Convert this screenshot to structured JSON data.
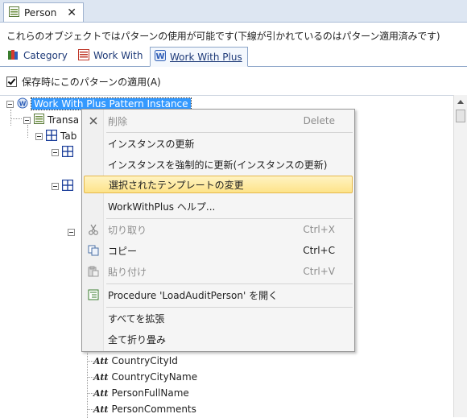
{
  "doc_tab": {
    "label": "Person",
    "close": "✕"
  },
  "description": "これらのオブジェクトではパターンの使用が可能です(下線が引かれているのはパターン適用済みです)",
  "pattern_tabs": [
    {
      "label": "Category",
      "icon": "category-icon"
    },
    {
      "label": "Work With",
      "icon": "work-with-icon"
    },
    {
      "label": "Work With Plus",
      "icon": "work-with-plus-icon",
      "active": true
    }
  ],
  "apply_on_save": {
    "label": "保存時にこのパターンの適用(A)",
    "checked": true
  },
  "tree": {
    "root": "Work With Plus Pattern Instance",
    "transaction": "Transa",
    "table": "Tab",
    "attributes": [
      "CountryCityId",
      "CountryCityName",
      "PersonFullName",
      "PersonComments"
    ]
  },
  "context_menu": {
    "items": [
      {
        "label": "削除",
        "shortcut": "Delete",
        "disabled": true,
        "icon": "delete-icon"
      },
      {
        "label": "インスタンスの更新"
      },
      {
        "label": "インスタンスを強制的に更新(インスタンスの更新)"
      },
      {
        "label": "選択されたテンプレートの変更",
        "highlighted": true
      },
      {
        "label": "WorkWithPlus ヘルプ..."
      },
      {
        "label": "切り取り",
        "shortcut": "Ctrl+X",
        "disabled": true,
        "icon": "cut-icon"
      },
      {
        "label": "コピー",
        "shortcut": "Ctrl+C",
        "icon": "copy-icon"
      },
      {
        "label": "貼り付け",
        "shortcut": "Ctrl+V",
        "disabled": true,
        "icon": "paste-icon"
      },
      {
        "label": "Procedure 'LoadAuditPerson' を開く",
        "icon": "procedure-icon"
      },
      {
        "label": "すべてを拡張"
      },
      {
        "label": "全て折り畳み"
      }
    ]
  }
}
